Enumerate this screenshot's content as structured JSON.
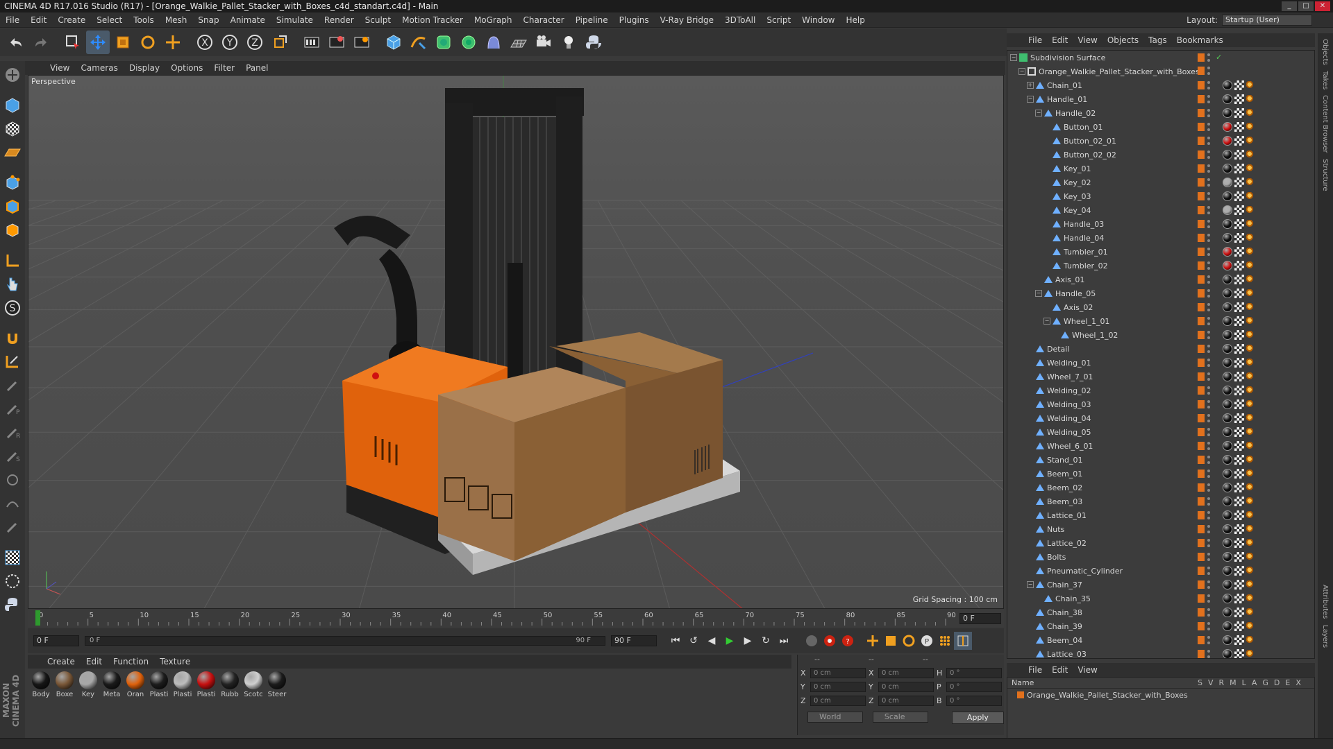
{
  "window": {
    "title": "CINEMA 4D R17.016 Studio (R17) - [Orange_Walkie_Pallet_Stacker_with_Boxes_c4d_standart.c4d] - Main"
  },
  "menubar": [
    "File",
    "Edit",
    "Create",
    "Select",
    "Tools",
    "Mesh",
    "Snap",
    "Animate",
    "Simulate",
    "Render",
    "Sculpt",
    "Motion Tracker",
    "MoGraph",
    "Character",
    "Pipeline",
    "Plugins",
    "V-Ray Bridge",
    "3DToAll",
    "Script",
    "Window",
    "Help"
  ],
  "layout": {
    "label": "Layout:",
    "value": "Startup (User)"
  },
  "viewport": {
    "menu": [
      "View",
      "Cameras",
      "Display",
      "Options",
      "Filter",
      "Panel"
    ],
    "label": "Perspective",
    "grid_spacing": "Grid Spacing : 100 cm"
  },
  "timeline": {
    "ticks": [
      "0",
      "5",
      "10",
      "15",
      "20",
      "25",
      "30",
      "35",
      "40",
      "45",
      "50",
      "55",
      "60",
      "65",
      "70",
      "75",
      "80",
      "85",
      "90"
    ],
    "current_frame": "0 F",
    "start": "0 F",
    "range_start": "0 F",
    "range_end": "90 F",
    "end": "90 F"
  },
  "materials_panel": {
    "menu": [
      "Create",
      "Edit",
      "Function",
      "Texture"
    ],
    "items": [
      {
        "label": "Body",
        "color": "#161616"
      },
      {
        "label": "Boxe",
        "color": "#7a5838"
      },
      {
        "label": "Key",
        "color": "#a8a8a8"
      },
      {
        "label": "Meta",
        "color": "#1a1a1a"
      },
      {
        "label": "Oran",
        "color": "#e0620c"
      },
      {
        "label": "Plasti",
        "color": "#1c1c1c"
      },
      {
        "label": "Plasti",
        "color": "#bdbdbd"
      },
      {
        "label": "Plasti",
        "color": "#c71010"
      },
      {
        "label": "Rubb",
        "color": "#222222"
      },
      {
        "label": "Scotc",
        "color": "#cfcfcf"
      },
      {
        "label": "Steer",
        "color": "#1b1b1b"
      }
    ]
  },
  "coords": {
    "headers": [
      "--",
      "--",
      "--"
    ],
    "rows": [
      {
        "a1": "X",
        "v1": "0 cm",
        "a2": "X",
        "v2": "0 cm",
        "a3": "H",
        "v3": "0 °"
      },
      {
        "a1": "Y",
        "v1": "0 cm",
        "a2": "Y",
        "v2": "0 cm",
        "a3": "P",
        "v3": "0 °"
      },
      {
        "a1": "Z",
        "v1": "0 cm",
        "a2": "Z",
        "v2": "0 cm",
        "a3": "B",
        "v3": "0 °"
      }
    ],
    "mode": "World",
    "size_mode": "Scale",
    "apply": "Apply"
  },
  "object_manager": {
    "menu": [
      "File",
      "Edit",
      "View",
      "Objects",
      "Tags",
      "Bookmarks"
    ],
    "objects": [
      {
        "name": "Subdivision Surface",
        "depth": 0,
        "exp": "-",
        "kind": "gen",
        "mat": ""
      },
      {
        "name": "Orange_Walkie_Pallet_Stacker_with_Boxes",
        "depth": 1,
        "exp": "-",
        "kind": "null",
        "mat": ""
      },
      {
        "name": "Chain_01",
        "depth": 2,
        "exp": "+",
        "kind": "poly",
        "mat": "#111"
      },
      {
        "name": "Handle_01",
        "depth": 2,
        "exp": "-",
        "kind": "poly",
        "mat": "#111"
      },
      {
        "name": "Handle_02",
        "depth": 3,
        "exp": "-",
        "kind": "poly",
        "mat": "#111"
      },
      {
        "name": "Button_01",
        "depth": 4,
        "exp": "",
        "kind": "poly",
        "mat": "#d01010"
      },
      {
        "name": "Button_02_01",
        "depth": 4,
        "exp": "",
        "kind": "poly",
        "mat": "#d01010"
      },
      {
        "name": "Button_02_02",
        "depth": 4,
        "exp": "",
        "kind": "poly",
        "mat": "#111"
      },
      {
        "name": "Key_01",
        "depth": 4,
        "exp": "",
        "kind": "poly",
        "mat": "#111"
      },
      {
        "name": "Key_02",
        "depth": 4,
        "exp": "",
        "kind": "poly",
        "mat": "#aaa"
      },
      {
        "name": "Key_03",
        "depth": 4,
        "exp": "",
        "kind": "poly",
        "mat": "#111"
      },
      {
        "name": "Key_04",
        "depth": 4,
        "exp": "",
        "kind": "poly",
        "mat": "#aaa"
      },
      {
        "name": "Handle_03",
        "depth": 4,
        "exp": "",
        "kind": "poly",
        "mat": "#111"
      },
      {
        "name": "Handle_04",
        "depth": 4,
        "exp": "",
        "kind": "poly",
        "mat": "#111"
      },
      {
        "name": "Tumbler_01",
        "depth": 4,
        "exp": "",
        "kind": "poly",
        "mat": "#d01010"
      },
      {
        "name": "Tumbler_02",
        "depth": 4,
        "exp": "",
        "kind": "poly",
        "mat": "#d01010"
      },
      {
        "name": "Axis_01",
        "depth": 3,
        "exp": "",
        "kind": "poly",
        "mat": "#111"
      },
      {
        "name": "Handle_05",
        "depth": 3,
        "exp": "-",
        "kind": "poly",
        "mat": "#111"
      },
      {
        "name": "Axis_02",
        "depth": 4,
        "exp": "",
        "kind": "poly",
        "mat": "#111"
      },
      {
        "name": "Wheel_1_01",
        "depth": 4,
        "exp": "-",
        "kind": "poly",
        "mat": "#111"
      },
      {
        "name": "Wheel_1_02",
        "depth": 5,
        "exp": "",
        "kind": "poly",
        "mat": "#111"
      },
      {
        "name": "Detail",
        "depth": 2,
        "exp": "",
        "kind": "poly",
        "mat": "#111"
      },
      {
        "name": "Welding_01",
        "depth": 2,
        "exp": "",
        "kind": "poly",
        "mat": "#111"
      },
      {
        "name": "Wheel_7_01",
        "depth": 2,
        "exp": "",
        "kind": "poly",
        "mat": "#111"
      },
      {
        "name": "Welding_02",
        "depth": 2,
        "exp": "",
        "kind": "poly",
        "mat": "#111"
      },
      {
        "name": "Welding_03",
        "depth": 2,
        "exp": "",
        "kind": "poly",
        "mat": "#111"
      },
      {
        "name": "Welding_04",
        "depth": 2,
        "exp": "",
        "kind": "poly",
        "mat": "#111"
      },
      {
        "name": "Welding_05",
        "depth": 2,
        "exp": "",
        "kind": "poly",
        "mat": "#111"
      },
      {
        "name": "Wheel_6_01",
        "depth": 2,
        "exp": "",
        "kind": "poly",
        "mat": "#111"
      },
      {
        "name": "Stand_01",
        "depth": 2,
        "exp": "",
        "kind": "poly",
        "mat": "#111"
      },
      {
        "name": "Beem_01",
        "depth": 2,
        "exp": "",
        "kind": "poly",
        "mat": "#111"
      },
      {
        "name": "Beem_02",
        "depth": 2,
        "exp": "",
        "kind": "poly",
        "mat": "#111"
      },
      {
        "name": "Beem_03",
        "depth": 2,
        "exp": "",
        "kind": "poly",
        "mat": "#111"
      },
      {
        "name": "Lattice_01",
        "depth": 2,
        "exp": "",
        "kind": "poly",
        "mat": "#111"
      },
      {
        "name": "Nuts",
        "depth": 2,
        "exp": "",
        "kind": "poly",
        "mat": "#111"
      },
      {
        "name": "Lattice_02",
        "depth": 2,
        "exp": "",
        "kind": "poly",
        "mat": "#111"
      },
      {
        "name": "Bolts",
        "depth": 2,
        "exp": "",
        "kind": "poly",
        "mat": "#111"
      },
      {
        "name": "Pneumatic_Cylinder",
        "depth": 2,
        "exp": "",
        "kind": "poly",
        "mat": "#111"
      },
      {
        "name": "Chain_37",
        "depth": 2,
        "exp": "-",
        "kind": "poly",
        "mat": "#111"
      },
      {
        "name": "Chain_35",
        "depth": 3,
        "exp": "",
        "kind": "poly",
        "mat": "#111"
      },
      {
        "name": "Chain_38",
        "depth": 2,
        "exp": "",
        "kind": "poly",
        "mat": "#111"
      },
      {
        "name": "Chain_39",
        "depth": 2,
        "exp": "",
        "kind": "poly",
        "mat": "#111"
      },
      {
        "name": "Beem_04",
        "depth": 2,
        "exp": "",
        "kind": "poly",
        "mat": "#111"
      },
      {
        "name": "Lattice_03",
        "depth": 2,
        "exp": "",
        "kind": "poly",
        "mat": "#111"
      }
    ]
  },
  "attributes_manager": {
    "menu": [
      "File",
      "Edit",
      "View"
    ],
    "name_header": "Name",
    "columns": [
      "S",
      "V",
      "R",
      "M",
      "L",
      "A",
      "G",
      "D",
      "E",
      "X"
    ],
    "layer_row": "Orange_Walkie_Pallet_Stacker_with_Boxes"
  },
  "side_tabs": [
    "Objects",
    "Takes",
    "Content Browser",
    "Structure"
  ],
  "side_tabs_bottom": [
    "Attributes",
    "Layers"
  ],
  "colors": {
    "accent_orange": "#e2711d",
    "panel": "#3c3c3c",
    "dark": "#2f2f2f"
  }
}
